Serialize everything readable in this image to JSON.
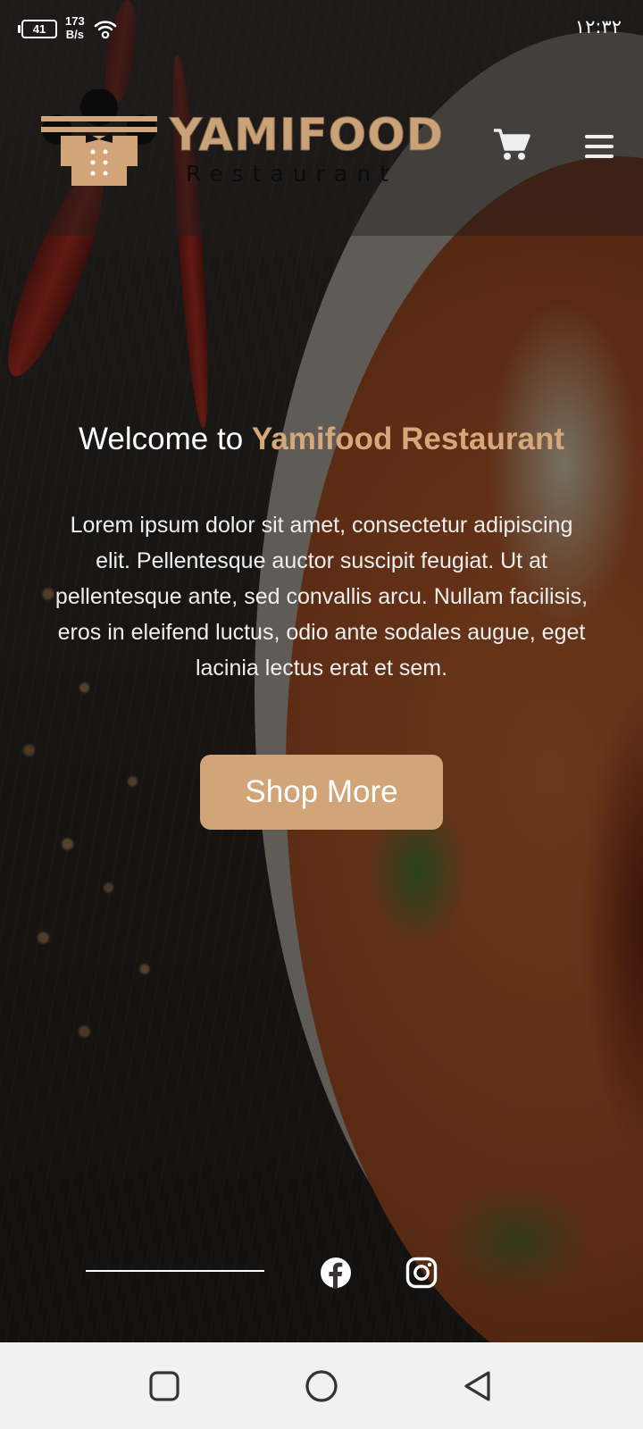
{
  "status_bar": {
    "battery": "41",
    "net_speed_value": "173",
    "net_speed_unit": "B/s",
    "time": "١٢:٣٢"
  },
  "header": {
    "brand_name": "YAMIFOOD",
    "brand_sub": "Restaurant",
    "icons": [
      "chef-logo-icon",
      "cart-icon",
      "hamburger-menu-icon"
    ]
  },
  "hero": {
    "welcome_prefix": "Welcome to",
    "welcome_accent": "Yamifood Restaurant",
    "description": "Lorem ipsum dolor sit amet, consectetur adipiscing elit. Pellentesque auctor suscipit feugiat. Ut at pellentesque ante, sed convallis arcu. Nullam facilisis, eros in eleifend luctus, odio ante sodales augue, eget lacinia lectus erat et sem.",
    "cta_label": "Shop More"
  },
  "social": {
    "icons": [
      "facebook-icon",
      "instagram-icon"
    ]
  },
  "nav_bar": {
    "icons": [
      "recent-apps-icon",
      "home-icon",
      "back-icon"
    ]
  },
  "colors": {
    "accent": "#d1a578",
    "accent_text": "#d6a779",
    "nav_bg": "#f1f1f1"
  }
}
